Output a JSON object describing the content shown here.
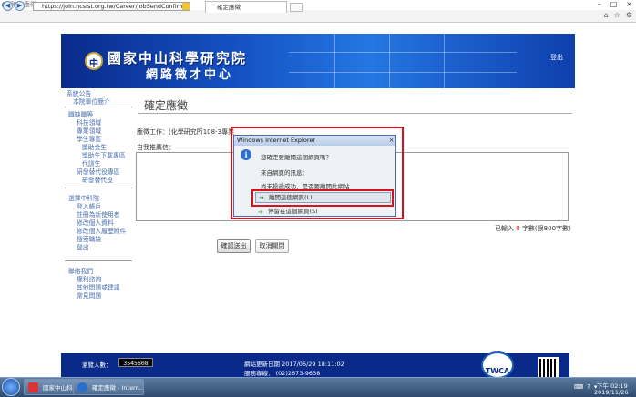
{
  "window": {
    "title": "確定應徵 - Internet Explorer"
  },
  "browser": {
    "url": "https://join.ncsist.org.tw/Career/JobSendConfirm",
    "tab_label": "確定應徵"
  },
  "header": {
    "logo_main": "國家中山科學研究院",
    "logo_sub": "網路徵才中心",
    "logout": "登出"
  },
  "sidebar": {
    "sections": [
      {
        "items": [
          "系統公告",
          "本院單位簡介"
        ]
      },
      {
        "items": [
          "職缺職等",
          "科技領域",
          "專業領域",
          "學生專區",
          "獎助金生",
          "獎助生下載專區",
          "代訓生",
          "研發替代役專區",
          "研發替代役"
        ]
      },
      {
        "items": [
          "選擇中科院",
          "登入帳戶",
          "註冊為新使用者",
          "修改個人資料",
          "修改個人履歷附件",
          "搜索職缺",
          "登出"
        ]
      },
      {
        "items": [
          "聯絡我們",
          "權利諮詢",
          "其他問題或建議",
          "常見問題"
        ]
      }
    ]
  },
  "main": {
    "page_title": "確定應徵",
    "job_label": "應徵工作：(化學研究所108-3專業",
    "recommend_label": "自我推薦信：",
    "charcount_prefix": "已輸入",
    "charcount_value": "0",
    "charcount_suffix": "字數(限800字數)",
    "confirm_button": "確認送出",
    "cancel_button": "取消關閉"
  },
  "dialog": {
    "title": "Windows Internet Explorer",
    "close": "×",
    "question": "您確定要離開這個網頁嗎？",
    "from_page": "來自網頁的訊息：",
    "message": "尚未投遞成功，是否要離開此網站",
    "leave_button": "離開這個網頁(L)",
    "stay_button": "停留在這個網頁(S)"
  },
  "footer": {
    "visitor_label": "瀏覽人數：",
    "visitor_count": "3545608",
    "updated": "網站更新日期 2017/06/29 18:11:02",
    "phone": "服務專線： (02)2673-9638",
    "twca": "TWCA"
  },
  "taskbar": {
    "task1": "國家中山科學研...",
    "task2": "確定應徵 - Intern...",
    "time": "下午 02:19",
    "date": "2019/11/26"
  }
}
